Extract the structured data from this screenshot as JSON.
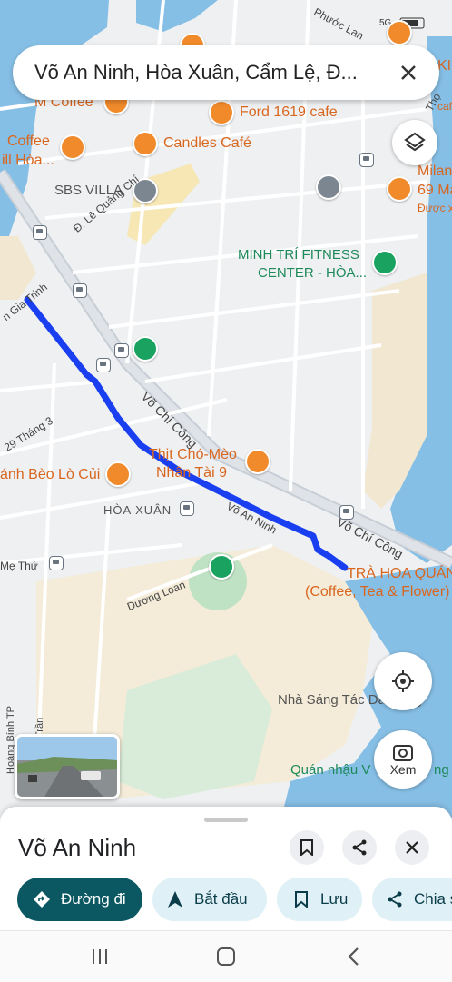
{
  "search": {
    "query": "Võ An Ninh, Hòa Xuân, Cẩm Lệ, Đ..."
  },
  "map_labels": {
    "coffee_left": "Coffee",
    "coffee_left_sub": "ill Hòa...",
    "m_coffee": "M Coffee",
    "ford_cafe": "Ford 1619 cafe",
    "candles_cafe": "Candles Café",
    "sbs_villa": "SBS VILLA",
    "minh_tri_1": "MINH TRÍ FITNESS",
    "minh_tri_2": "CENTER - HÒA...",
    "milan_1": "Milan",
    "milan_2": "69 Ma",
    "milan_3": "Được x",
    "kic": "KIC",
    "caf": "caf",
    "thit_cho_1": "Thịt Chó-Mèo",
    "thit_cho_2": "Nhân Tài 9",
    "banh_beo": "ánh Bèo Lò Củi",
    "hoa_xuan": "HÒA XUÂN",
    "tra_hoa_quan_1": "TRÀ HOA QUÁN",
    "tra_hoa_quan_2": "(Coffee, Tea & Flower)",
    "nha_sang_tac": "Nhà Sáng Tác Đà Nẵng",
    "quan_nhau": "Quán nhậu V",
    "quan_nhau_2": "ng",
    "st_le_quang_chi": "Đ. Lê Quảng Chí",
    "st_gia_trinh": "n Gia Trinh",
    "st_29_thang_3": "29 Tháng 3",
    "st_vo_chi_cong_1": "Võ Chí Công",
    "st_vo_chi_cong_2": "Võ Chí Công",
    "st_vo_an_ninh": "Võ An Ninh",
    "st_duong_loan": "Dương Loan",
    "st_me_thu": "Mẹ Thứ",
    "st_hoang": "Hoàng Bính TP",
    "st_tran": "Trần",
    "st_phuoc_lan": "Phước Lan",
    "st_tho": "Thọ"
  },
  "buttons": {
    "xem": "Xem"
  },
  "sheet": {
    "title": "Võ An Ninh",
    "chips": [
      {
        "label": "Đường đi",
        "icon": "directions-icon"
      },
      {
        "label": "Bắt đầu",
        "icon": "navigation-arrow-icon"
      },
      {
        "label": "Lưu",
        "icon": "bookmark-icon"
      },
      {
        "label": "Chia s",
        "icon": "share-icon"
      }
    ]
  },
  "status_bar": {
    "network": "5G"
  },
  "colors": {
    "route": "#1a3ff0",
    "primary_chip": "#0b5862",
    "water": "#7fb8e0",
    "poi_orange": "#d9661f"
  }
}
